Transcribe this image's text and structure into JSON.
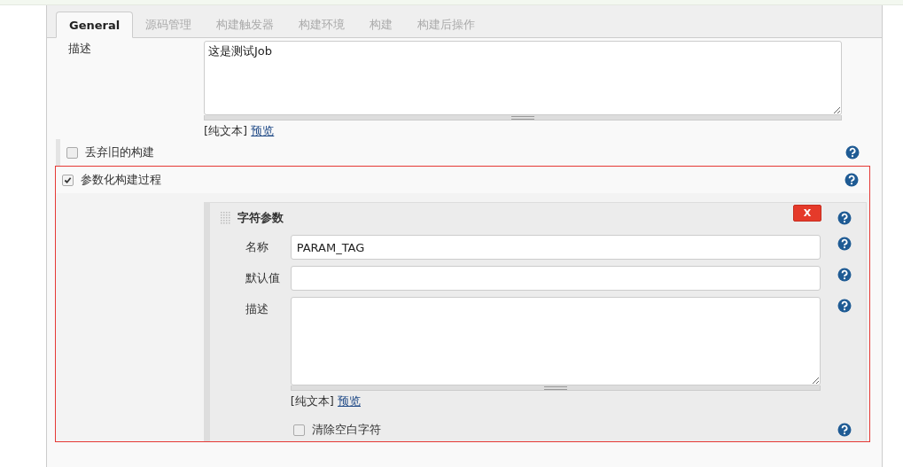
{
  "tabs": [
    {
      "label": "General",
      "selected": true
    },
    {
      "label": "源码管理",
      "selected": false
    },
    {
      "label": "构建触发器",
      "selected": false
    },
    {
      "label": "构建环境",
      "selected": false
    },
    {
      "label": "构建",
      "selected": false
    },
    {
      "label": "构建后操作",
      "selected": false
    }
  ],
  "description": {
    "label": "描述",
    "value": "这是测试Job",
    "format": "[纯文本]",
    "preview_link": "预览"
  },
  "options": [
    {
      "label": "丢弃旧的构建",
      "checked": false,
      "highlighted": false
    },
    {
      "label": "参数化构建过程",
      "checked": true,
      "highlighted": true
    }
  ],
  "parameter": {
    "title": "字符参数",
    "delete_button": "X",
    "fields": [
      {
        "kind": "input",
        "label": "名称",
        "value": "PARAM_TAG"
      },
      {
        "kind": "input",
        "label": "默认值"
      },
      {
        "kind": "textarea",
        "label": "描述"
      }
    ],
    "format": "[纯文本]",
    "preview_link": "预览",
    "trim": {
      "label": "清除空白字符",
      "checked": false
    }
  }
}
